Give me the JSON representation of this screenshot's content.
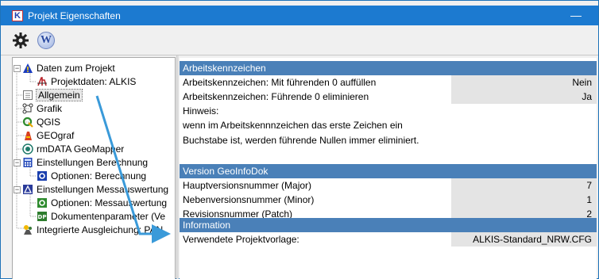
{
  "window": {
    "title": "Projekt Eigenschaften",
    "minimize_glyph": "—"
  },
  "toolbar": {
    "settings_icon": "gear-icon",
    "wiki_label": "W"
  },
  "tree": {
    "items": [
      {
        "label": "Daten zum Projekt"
      },
      {
        "label": "Projektdaten: ALKIS"
      },
      {
        "label": "Allgemein"
      },
      {
        "label": "Grafik"
      },
      {
        "label": "QGIS"
      },
      {
        "label": "GEOgraf"
      },
      {
        "label": "rmDATA GeoMapper"
      },
      {
        "label": "Einstellungen Berechnung"
      },
      {
        "label": "Optionen: Berechnung"
      },
      {
        "label": "Einstellungen Messauswertung"
      },
      {
        "label": "Optionen: Messauswertung"
      },
      {
        "label": "Dokumentenparameter (Ve"
      },
      {
        "label": "Integrierte Ausgleichung: PAN"
      }
    ]
  },
  "sections": {
    "arbeitskennzeichen": {
      "title": "Arbeitskennzeichen",
      "rows": [
        {
          "label": "Arbeitskennzeichen: Mit führenden 0 auffüllen",
          "value": "Nein"
        },
        {
          "label": "Arbeitskennzeichen: Führende 0 eliminieren",
          "value": "Ja"
        }
      ],
      "notes": [
        "Hinweis:",
        "wenn im Arbeitskennnzeichen das erste Zeichen ein",
        "Buchstabe ist, werden führende Nullen immer eliminiert."
      ]
    },
    "version": {
      "title": "Version GeoInfoDok",
      "rows": [
        {
          "label": "Hauptversionsnummer (Major)",
          "value": "7"
        },
        {
          "label": "Nebenversionsnummer (Minor)",
          "value": "1"
        },
        {
          "label": "Revisionsnummer (Patch)",
          "value": "2"
        }
      ]
    },
    "information": {
      "title": "Information",
      "rows": [
        {
          "label": "Verwendete Projektvorlage:",
          "value": "ALKIS-Standard_NRW.CFG"
        }
      ]
    }
  },
  "colors": {
    "titlebar": "#1c7ad0",
    "section_header": "#4a80b8",
    "annotation_arrow": "#3a9ad9"
  }
}
